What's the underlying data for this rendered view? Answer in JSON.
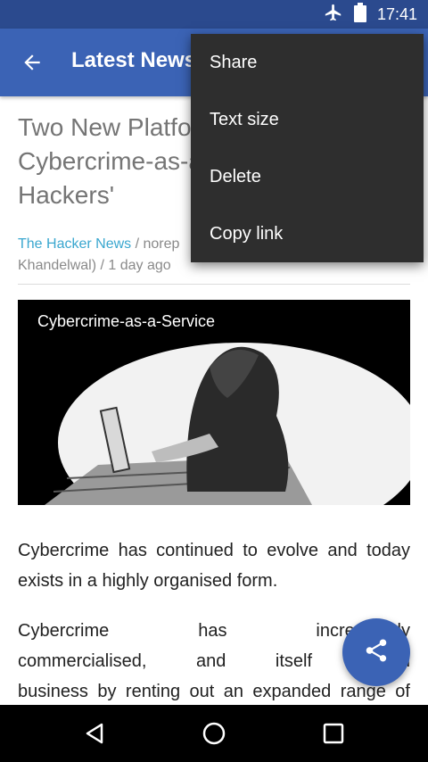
{
  "status_bar": {
    "time": "17:41",
    "icons": [
      "airplane-icon",
      "battery-icon"
    ]
  },
  "app_bar": {
    "title": "Latest News",
    "back_icon": "arrow-back-icon"
  },
  "article": {
    "headline": "Two New Platforms Selling Cybercrime-as-a-Service to Hackers'",
    "headline_visible_lines": [
      "Two New Platfor",
      "Cybercrime-as-a-",
      "Hackers'"
    ],
    "source": "The Hacker News",
    "meta_line1_rest": " / norep",
    "meta_line2": "Khandelwal) / 1 day ago",
    "image_caption": "Cybercrime-as-a-Service",
    "paragraph1": "Cybercrime has continued to evolve and today exists in a highly organised form.",
    "paragraph2_lines": [
      "Cybercrime has increasingly",
      "commercialised, and itself becon",
      "business by renting out an expanded range of"
    ]
  },
  "overflow_menu": {
    "items": [
      "Share",
      "Text size",
      "Delete",
      "Copy link"
    ]
  },
  "fab": {
    "icon": "share-icon"
  },
  "nav_bar": {
    "icons": [
      "back-triangle-icon",
      "home-circle-icon",
      "recents-square-icon"
    ]
  },
  "colors": {
    "status_bar": "#2b4a8e",
    "app_bar": "#3b63b5",
    "accent_link": "#3aa7cf",
    "menu_bg": "#2e2e2e",
    "fab": "#3b63b5"
  }
}
